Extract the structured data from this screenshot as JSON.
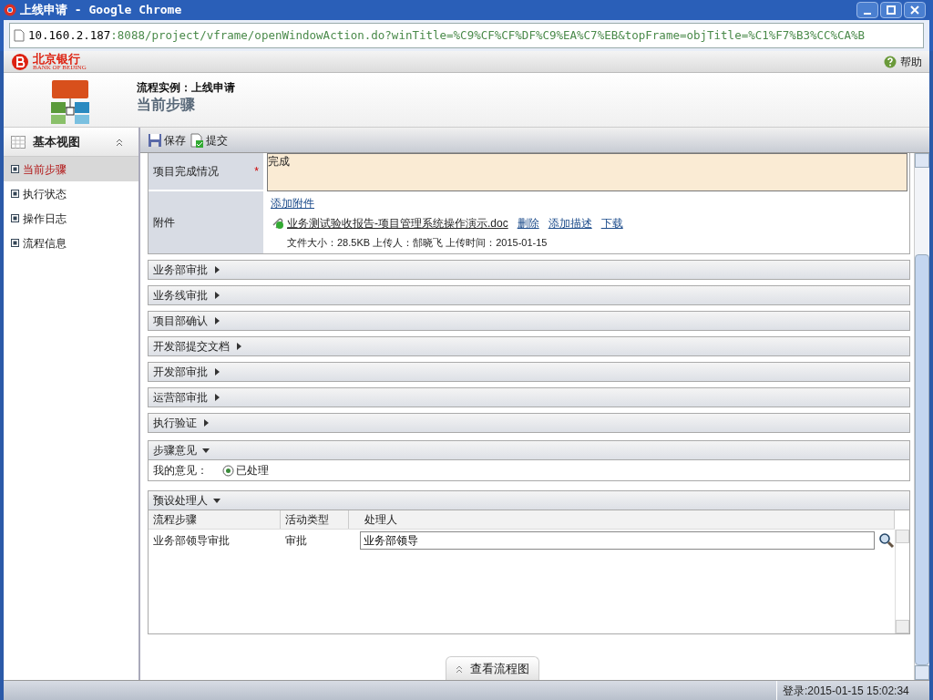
{
  "window": {
    "title": "上线申请 - Google Chrome"
  },
  "address_bar": {
    "host": "10.160.2.187",
    "path": ":8088/project/vframe/openWindowAction.do?winTitle=%C9%CF%CF%DF%C9%EA%C7%EB&topFrame=objTitle=%C1%F7%B3%CC%CA%B"
  },
  "brand": {
    "name": "北京银行",
    "subtitle": "BANK OF BEIJING",
    "help": "帮助"
  },
  "header": {
    "instance": "流程实例：上线申请",
    "title": "当前步骤"
  },
  "sidebar": {
    "title": "基本视图",
    "items": [
      {
        "label": "当前步骤",
        "selected": true
      },
      {
        "label": "执行状态",
        "selected": false
      },
      {
        "label": "操作日志",
        "selected": false
      },
      {
        "label": "流程信息",
        "selected": false
      }
    ]
  },
  "toolbar": [
    "保存",
    "提交"
  ],
  "form": {
    "completion": {
      "label": "项目完成情况",
      "required": "*",
      "value": "完成"
    },
    "attachment": {
      "label": "附件",
      "add": "添加附件",
      "file": "业务测试验收报告-项目管理系统操作演示.doc",
      "actions": [
        "删除",
        "添加描述",
        "下载"
      ],
      "meta": "文件大小：28.5KB 上传人：郜晓飞 上传时间：2015-01-15"
    }
  },
  "sections": [
    {
      "title": "业务部审批",
      "expanded": false
    },
    {
      "title": "业务线审批",
      "expanded": false
    },
    {
      "title": "项目部确认",
      "expanded": false
    },
    {
      "title": "开发部提交文档",
      "expanded": false
    },
    {
      "title": "开发部审批",
      "expanded": false
    },
    {
      "title": "运营部审批",
      "expanded": false
    },
    {
      "title": "执行验证",
      "expanded": false
    }
  ],
  "opinion": {
    "title": "步骤意见",
    "expanded": true,
    "label": "我的意见：",
    "option": {
      "label": "已处理",
      "selected": true
    }
  },
  "preset": {
    "title": "预设处理人",
    "expanded": true,
    "columns": [
      "流程步骤",
      "活动类型",
      "处理人"
    ],
    "rows": [
      {
        "step": "业务部领导审批",
        "type": "审批",
        "handler": "业务部领导"
      }
    ]
  },
  "flow_button": "查看流程图",
  "status_bar": "登录:2015-01-15  15:02:34"
}
